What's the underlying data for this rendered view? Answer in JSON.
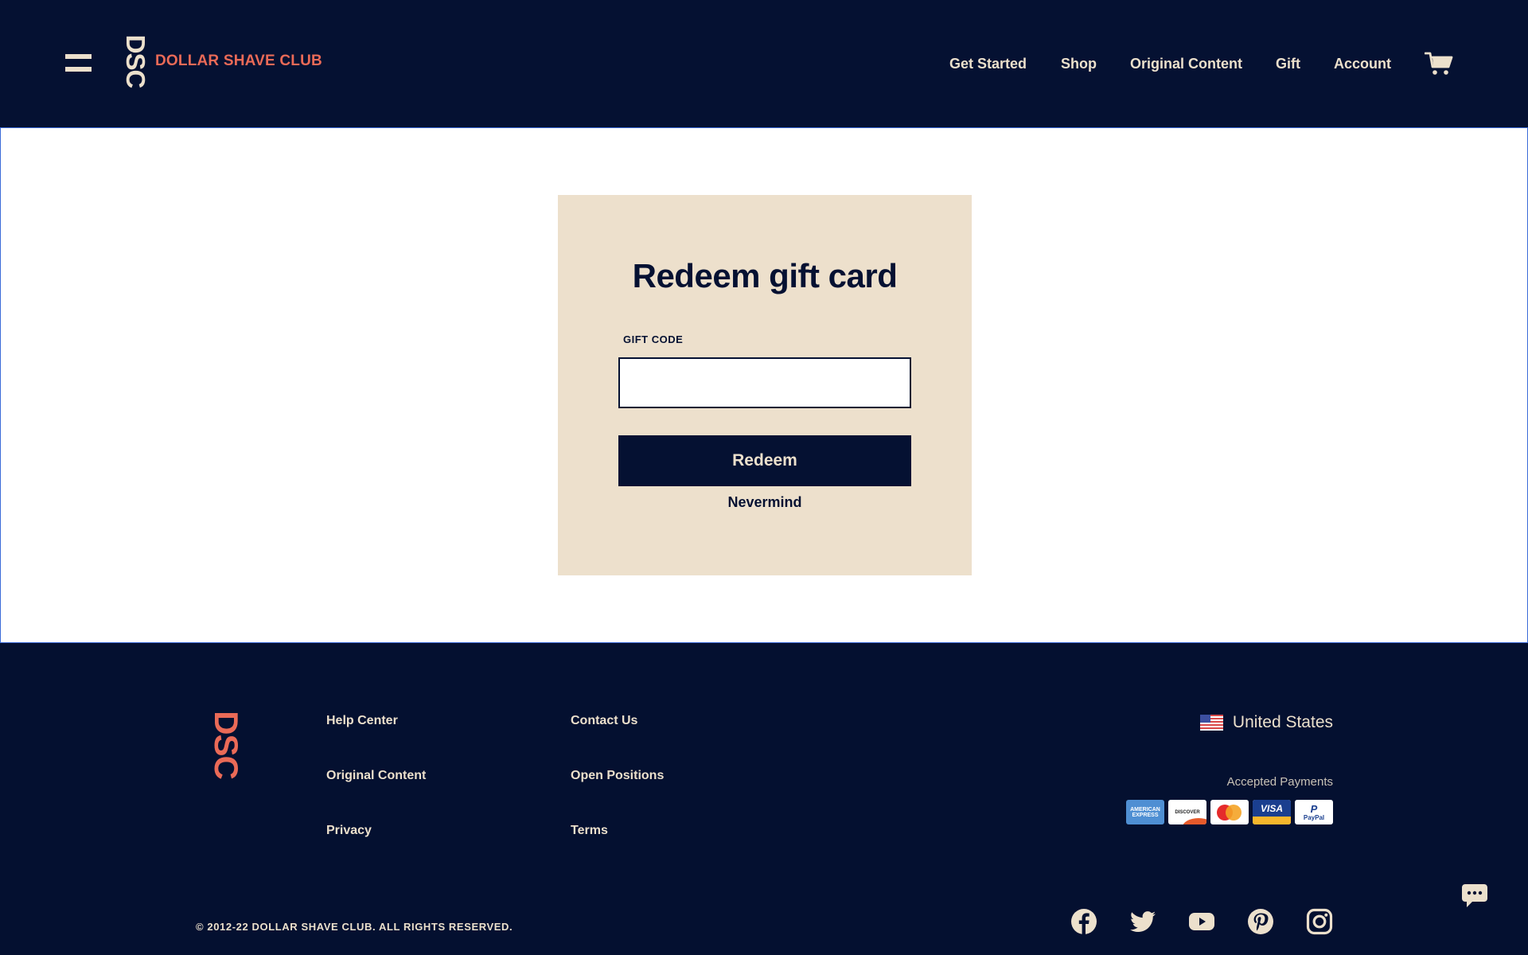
{
  "header": {
    "logo_mark": "DSC",
    "logo_text": "DOLLAR SHAVE CLUB",
    "nav": [
      "Get Started",
      "Shop",
      "Original Content",
      "Gift",
      "Account"
    ]
  },
  "card": {
    "title": "Redeem gift card",
    "field_label": "GIFT CODE",
    "field_value": "",
    "redeem_label": "Redeem",
    "nevermind_label": "Nevermind"
  },
  "footer": {
    "logo_mark": "DSC",
    "links_col1": [
      "Help Center",
      "Original Content",
      "Privacy"
    ],
    "links_col2": [
      "Contact Us",
      "Open Positions",
      "Terms"
    ],
    "country": "United States",
    "payments_label": "Accepted Payments",
    "payments": [
      "AMERICAN EXPRESS",
      "DISCOVER",
      "mastercard",
      "VISA",
      "PayPal"
    ],
    "copyright": "© 2012-22 DOLLAR SHAVE CLUB. ALL RIGHTS RESERVED.",
    "social": [
      "facebook-icon",
      "twitter-icon",
      "youtube-icon",
      "pinterest-icon",
      "instagram-icon"
    ]
  },
  "colors": {
    "navy": "#051132",
    "cream": "#ece0cc",
    "coral": "#ea6a57",
    "card_bg": "#ede0cc"
  }
}
